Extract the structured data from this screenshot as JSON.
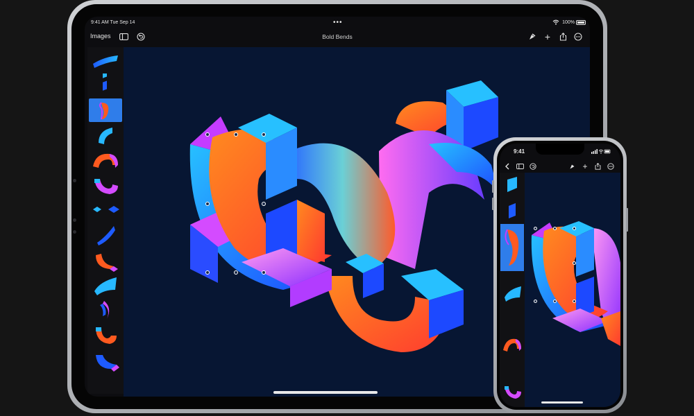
{
  "ipad": {
    "status": {
      "time": "9:41 AM",
      "date": "Tue Sep 14",
      "more": "•••",
      "battery": "100%"
    },
    "toolbar": {
      "back_label": "Images",
      "title": "Bold Bends",
      "icons": [
        "sidebar-icon",
        "undo-icon",
        "pen-nib-icon",
        "plus-icon",
        "share-icon",
        "more-icon"
      ]
    },
    "sidebar": {
      "thumbnail_count": 13,
      "selected_index": 2
    },
    "canvas": {
      "background": "#071633"
    }
  },
  "iphone": {
    "status": {
      "time": "9:41"
    },
    "toolbar": {
      "icons": [
        "back-chevron-icon",
        "sidebar-icon",
        "undo-icon",
        "pen-nib-icon",
        "plus-icon",
        "share-icon",
        "more-icon"
      ]
    },
    "sidebar": {
      "selected_index": 2
    }
  },
  "colors": {
    "accent_blue": "#2f7dea",
    "orange": "#ff5a1f",
    "magenta": "#d44bff",
    "cyan": "#27b8ff"
  }
}
